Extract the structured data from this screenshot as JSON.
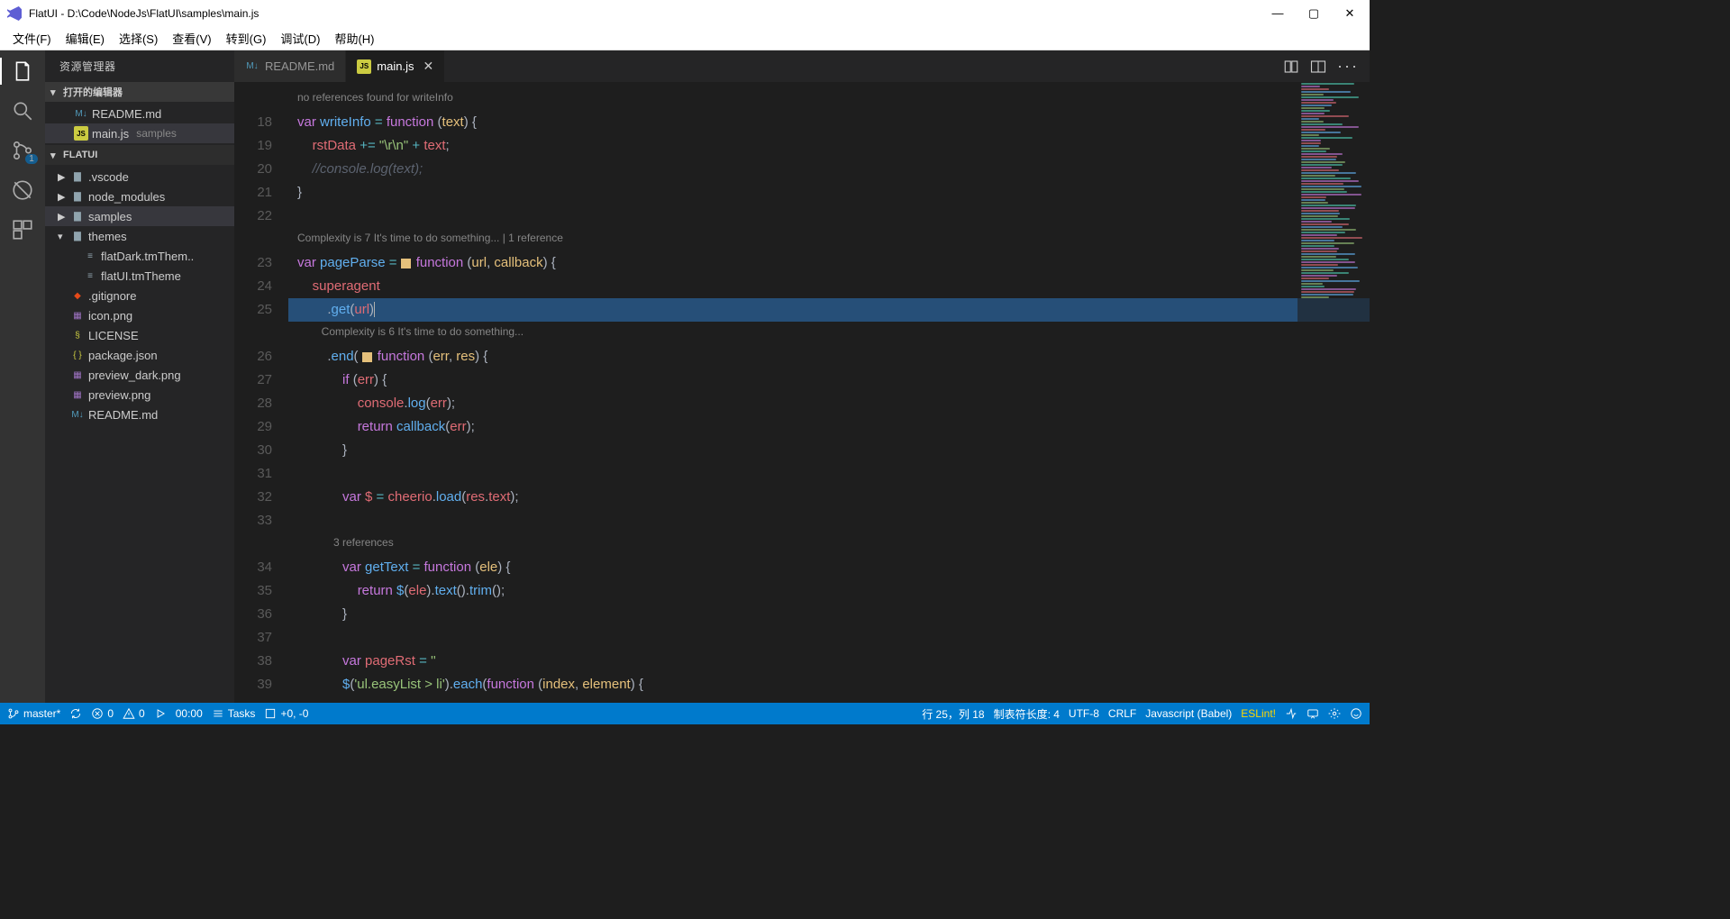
{
  "window": {
    "title": "FlatUI - D:\\Code\\NodeJs\\FlatUI\\samples\\main.js"
  },
  "menu": [
    "文件(F)",
    "编辑(E)",
    "选择(S)",
    "查看(V)",
    "转到(G)",
    "调试(D)",
    "帮助(H)"
  ],
  "activity": {
    "scm_badge": "1"
  },
  "sidebar": {
    "title": "资源管理器",
    "open_editors_header": "打开的编辑器",
    "project_header": "FLATUI",
    "open_editors": [
      {
        "icon": "M↓",
        "cls": "md",
        "name": "README.md"
      },
      {
        "icon": "JS",
        "cls": "js",
        "name": "main.js",
        "dim": "samples",
        "sel": true
      }
    ],
    "tree": [
      {
        "indent": 0,
        "chev": "▶",
        "icon": "folder",
        "lbl": ".vscode"
      },
      {
        "indent": 0,
        "chev": "▶",
        "icon": "folder",
        "lbl": "node_modules"
      },
      {
        "indent": 0,
        "chev": "▶",
        "icon": "folder",
        "lbl": "samples",
        "sel": true
      },
      {
        "indent": 0,
        "chev": "▾",
        "icon": "folder",
        "lbl": "themes"
      },
      {
        "indent": 1,
        "chev": "",
        "icon": "tm",
        "lbl": "flatDark.tmThem.."
      },
      {
        "indent": 1,
        "chev": "",
        "icon": "tm",
        "lbl": "flatUI.tmTheme"
      },
      {
        "indent": 0,
        "chev": "",
        "icon": "git",
        "lbl": ".gitignore"
      },
      {
        "indent": 0,
        "chev": "",
        "icon": "img",
        "lbl": "icon.png"
      },
      {
        "indent": 0,
        "chev": "",
        "icon": "lic",
        "lbl": "LICENSE"
      },
      {
        "indent": 0,
        "chev": "",
        "icon": "json",
        "lbl": "package.json"
      },
      {
        "indent": 0,
        "chev": "",
        "icon": "img",
        "lbl": "preview_dark.png"
      },
      {
        "indent": 0,
        "chev": "",
        "icon": "img",
        "lbl": "preview.png"
      },
      {
        "indent": 0,
        "chev": "",
        "icon": "md",
        "lbl": "README.md"
      }
    ]
  },
  "tabs": [
    {
      "icon": "M↓",
      "cls": "md",
      "name": "README.md"
    },
    {
      "icon": "JS",
      "cls": "js",
      "name": "main.js",
      "active": true
    }
  ],
  "codelens": {
    "l1": "no references found for writeInfo",
    "l2": "Complexity is 7 It's time to do something... | 1 reference",
    "l3": "Complexity is 6 It's time to do something...",
    "l4": "3 references"
  },
  "line_numbers": [
    "18",
    "19",
    "20",
    "21",
    "22",
    "23",
    "24",
    "25",
    "26",
    "27",
    "28",
    "29",
    "30",
    "31",
    "32",
    "33",
    "34",
    "35",
    "36",
    "37",
    "38",
    "39"
  ],
  "status": {
    "left": {
      "branch": "master*",
      "errors": "0",
      "warnings": "0",
      "time": "00:00",
      "tasks": "Tasks",
      "coords": "+0, -0"
    },
    "right": {
      "pos": "行 25，列 18",
      "tab": "制表符长度: 4",
      "enc": "UTF-8",
      "eol": "CRLF",
      "lang": "Javascript (Babel)",
      "eslint": "ESLint!"
    }
  }
}
